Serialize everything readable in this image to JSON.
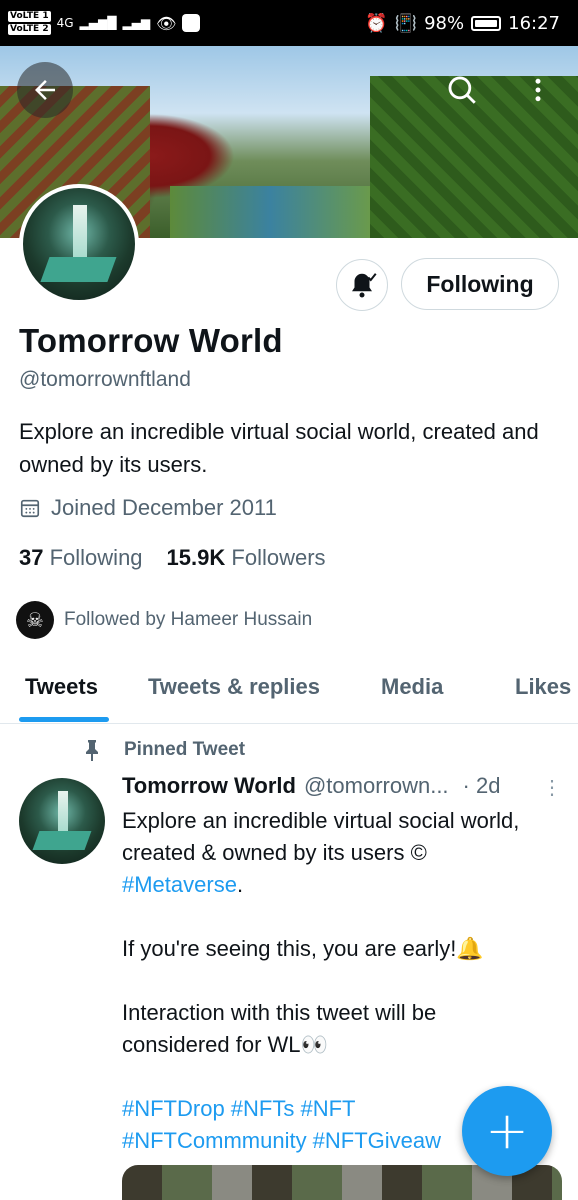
{
  "status_bar": {
    "volte1": "VoLTE 1",
    "volte2": "VoLTE 2",
    "network": "4G",
    "battery_pct": "98%",
    "time": "16:27"
  },
  "profile": {
    "name": "Tomorrow World",
    "handle": "@tomorrownftland",
    "bio": "Explore an incredible virtual social world, created and owned by its users.",
    "joined": "Joined December 2011",
    "following_count": "37",
    "following_label": "Following",
    "followers_count": "15.9K",
    "followers_label": "Followers",
    "followed_by": "Followed by Hameer Hussain",
    "follow_button": "Following"
  },
  "tabs": [
    {
      "label": "Tweets",
      "active": true
    },
    {
      "label": "Tweets & replies",
      "active": false
    },
    {
      "label": "Media",
      "active": false
    },
    {
      "label": "Likes",
      "active": false
    }
  ],
  "tweet": {
    "pinned_label": "Pinned Tweet",
    "author_name": "Tomorrow World",
    "author_handle": "@tomorrown...",
    "time": "· 2d",
    "line1": "Explore an incredible virtual social world,",
    "line2": "created & owned by its users ©",
    "tag_metaverse": "#Metaverse",
    "period": ".",
    "line3": "If you're seeing this, you are early!🔔",
    "line4": "Interaction with this tweet will be",
    "line5": "considered for WL👀",
    "tags_line1": "#NFTDrop #NFTs #NFT",
    "tags_line2": "#NFTCommmunity #NFTGiveaw"
  },
  "colors": {
    "accent": "#1d9bf0",
    "text_primary": "#0f1419",
    "text_secondary": "#536471"
  },
  "icons": [
    "back-arrow-icon",
    "search-icon",
    "more-vertical-icon",
    "bell-icon",
    "calendar-icon",
    "pin-icon",
    "compose-plus-icon"
  ]
}
